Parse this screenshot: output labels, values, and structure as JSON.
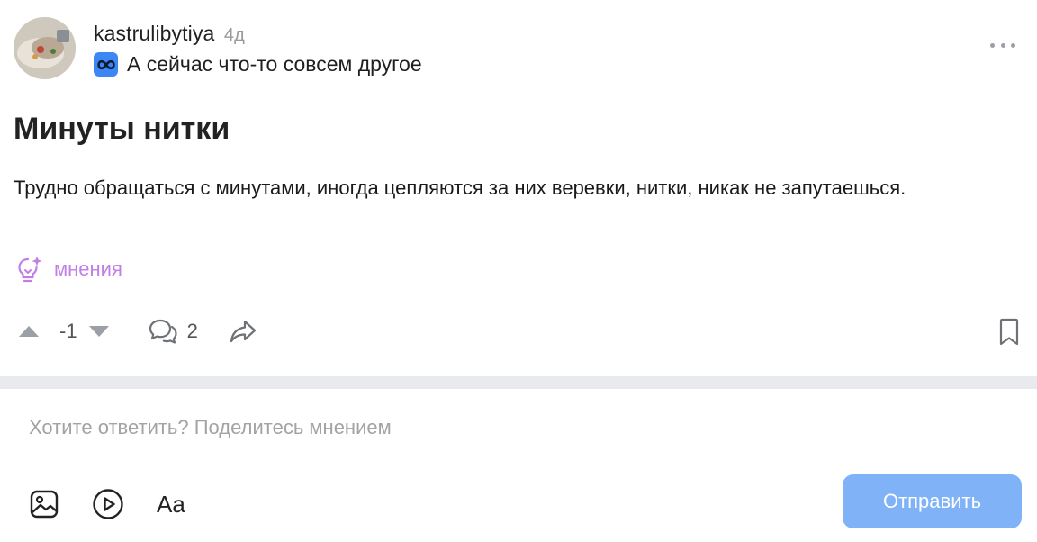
{
  "post": {
    "author": "kastrulibytiya",
    "age": "4д",
    "community": "А сейчас что-то совсем другое",
    "title": "Минуты нитки",
    "body": "Трудно обращаться с минутами, иногда цепляются за них веревки, нитки, никак не запутаешься.",
    "tag": "мнения",
    "score": "-1",
    "comments": "2"
  },
  "composer": {
    "placeholder": "Хотите ответить? Поделитесь мнением",
    "aa_label": "Aa",
    "send_label": "Отправить"
  },
  "icons": {
    "community_badge": "infinity-icon",
    "tag": "lightbulb-sparkle-icon",
    "upvote": "triangle-up-icon",
    "downvote": "triangle-down-icon",
    "comments": "chat-bubbles-icon",
    "share": "share-arrow-icon",
    "bookmark": "bookmark-icon",
    "image": "image-icon",
    "video": "play-circle-icon",
    "more": "more-dots-icon"
  },
  "colors": {
    "accent": "#3d87f5",
    "send_button": "#7fb2f7",
    "tag": "#c07fe6",
    "divider": "#e9eaee"
  }
}
